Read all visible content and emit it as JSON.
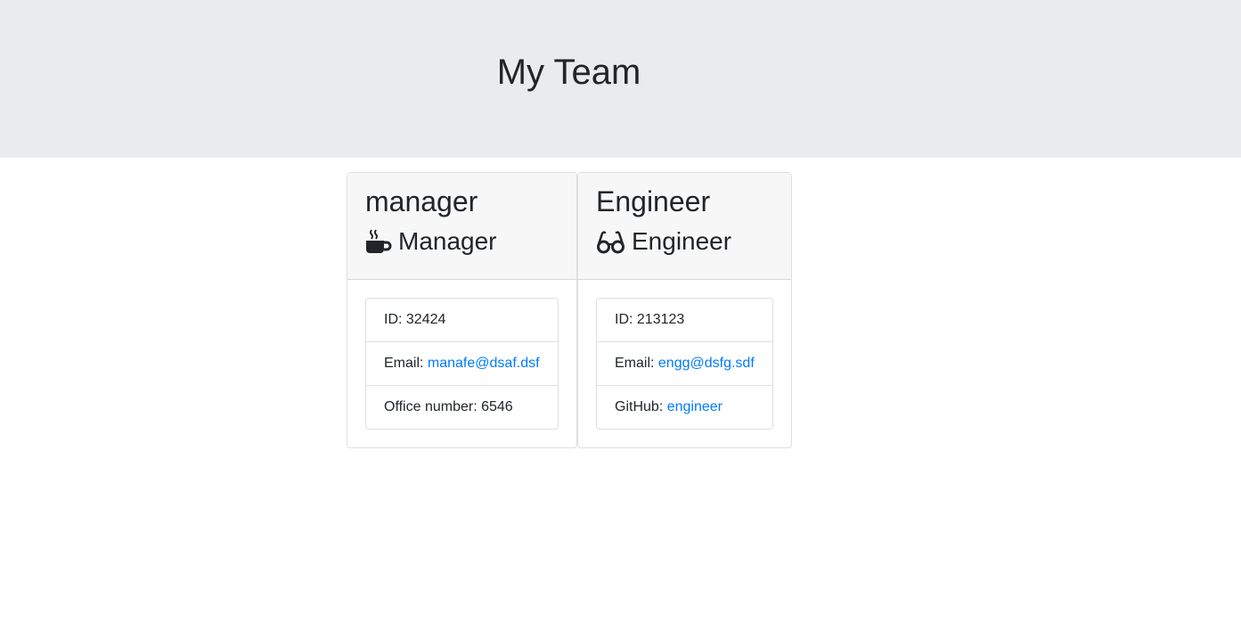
{
  "header": {
    "title": "My Team"
  },
  "employees": [
    {
      "name": "manager",
      "role": "Manager",
      "role_icon": "coffee-mug-icon",
      "id_label": "ID:",
      "id": "32424",
      "email_label": "Email:",
      "email": "manafe@dsaf.dsf",
      "extra_label": "Office number:",
      "extra_value": "6546"
    },
    {
      "name": "Engineer",
      "role": "Engineer",
      "role_icon": "glasses-icon",
      "id_label": "ID:",
      "id": "213123",
      "email_label": "Email:",
      "email": "engg@dsfg.sdf",
      "extra_label": "GitHub:",
      "extra_value": "engineer"
    }
  ],
  "colors": {
    "jumbotron_bg": "#e9ecef",
    "card_header_bg": "#f7f7f7",
    "link": "#007bff",
    "text": "#212529"
  }
}
